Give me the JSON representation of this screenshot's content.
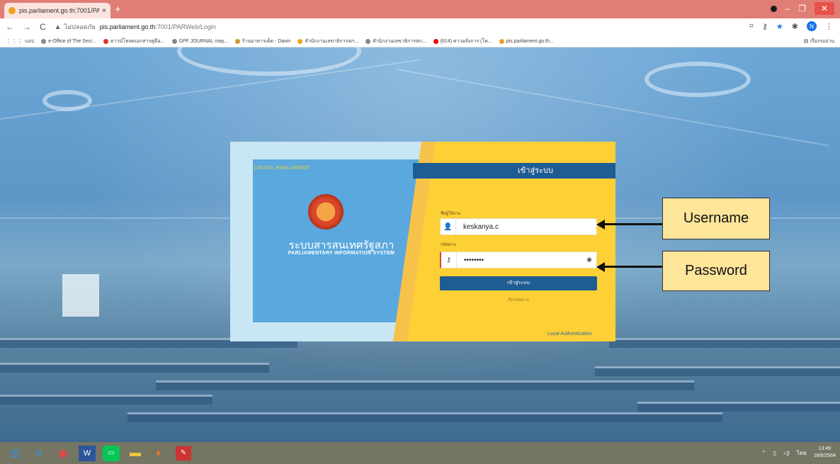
{
  "browser": {
    "tab_title": "pis.parliament.go.th:7001/PARW...",
    "tab_close": "×",
    "new_tab": "+",
    "security_label": "ไม่ปลอดภัย",
    "url_host": "pis.parliament.go.th",
    "url_path": ":7001/PARWeb/Login",
    "bookmarks": [
      "แอป",
      "e-Office of The Secr...",
      "ดาวน์โหลดเอกสารคู่มือ...",
      "GPF JOURNAL may...",
      "ร้านอาหารเด็ด - Davin",
      "สำนักงานเลขาธิการสภ...",
      "สำนักงานเลขาธิการสภ...",
      "(814) ดาวอลังการ (โค...",
      "pis.parliament.go.th..."
    ],
    "bookmarks_other": "เรื่องรออ่าน",
    "profile_initial": "N"
  },
  "login": {
    "brand": "DIGITAL PARLIAMENT",
    "system_name_th": "ระบบสารสนเทศรัฐสภา",
    "system_name_en": "PARLIAMENTARY INFORMATION SYSTEM",
    "header": "เข้าสู่ระบบ",
    "username_label": "ชื่อผู้ใช้งาน",
    "username_value": "keskanya.c",
    "password_label": "รหัสผ่าน",
    "password_value": "••••••••",
    "submit_label": "เข้าสู่ระบบ",
    "forgot_label": "ลืมรหัสผ่าน",
    "local_auth": "Local Authentication"
  },
  "annotations": {
    "username": "Username",
    "password": "Password"
  },
  "taskbar": {
    "tray_lang": "ไทย",
    "clock_time": "13:49",
    "clock_date": "18/6/2564"
  },
  "colors": {
    "tab_strip": "#e07d75",
    "card_yellow": "#fdd035",
    "header_blue": "#1e5c94",
    "panel_blue": "#5aa8dd",
    "callout": "#fde59a"
  }
}
